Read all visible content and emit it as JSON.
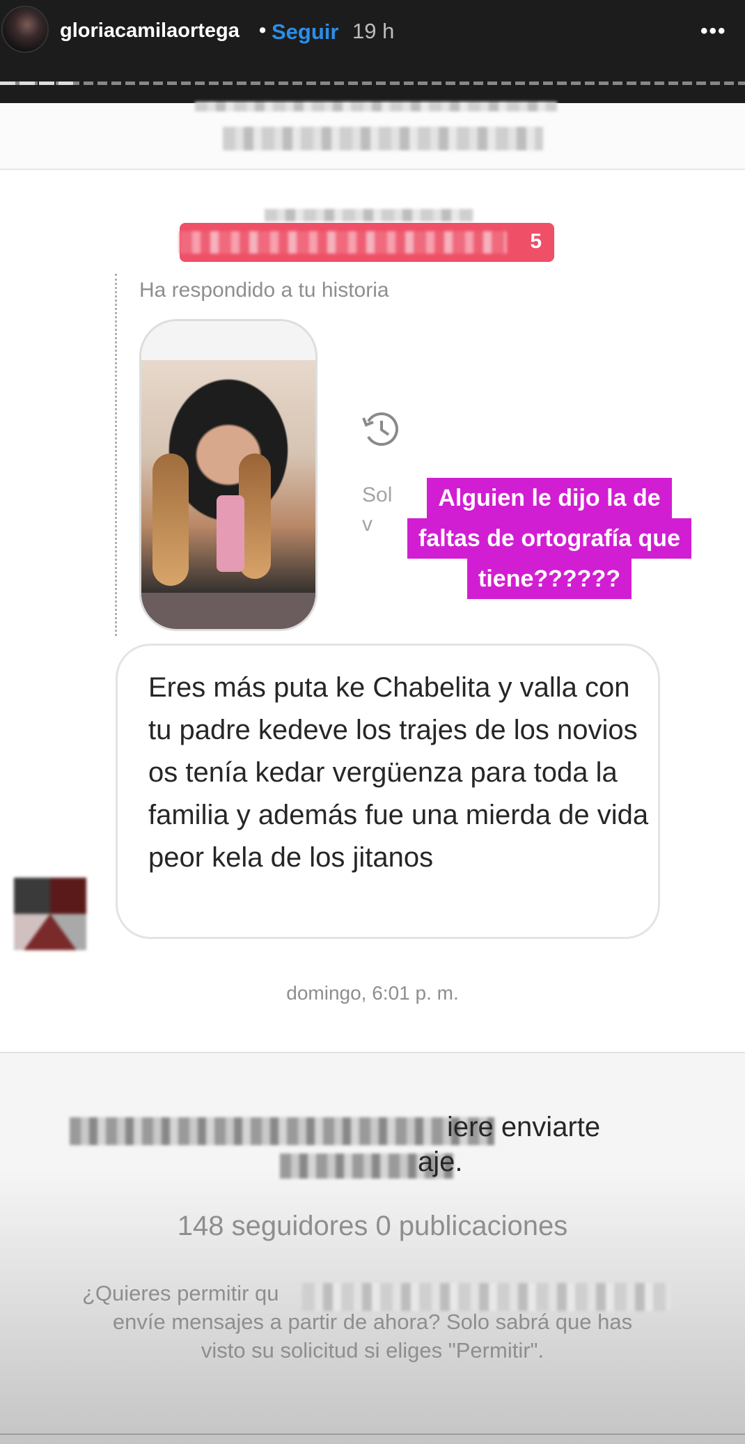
{
  "story": {
    "username": "gloriacamilaortega",
    "separator": "•",
    "follow_label": "Seguir",
    "time_ago": "19 h",
    "more_icon": "more-horizontal-icon",
    "more_label": "•••"
  },
  "chat": {
    "pill_number": "5",
    "reply_label": "Ha respondido a tu historia",
    "history_icon": "history-clock-icon",
    "partial_text_1": "Sol",
    "partial_text_2": "v",
    "caption_lines": [
      "Alguien le dijo la de",
      "faltas de ortografía que",
      "tiene??????"
    ],
    "message_text": "Eres más puta ke Chabelita y valla con tu padre kedeve los trajes de los novios os tenía kedar vergüenza para toda la familia y además fue una mierda de vida peor kela de los jitanos",
    "timestamp": "domingo, 6:01 p. m."
  },
  "request": {
    "line1_tail": "iere enviarte",
    "line2_tail": "aje.",
    "followers_text": "148 seguidores 0 publicaciones",
    "permit_line1": "¿Quieres permitir qu",
    "permit_line2": "envíe mensajes a partir de ahora? Solo sabrá que has",
    "permit_line3": "visto su solicitud si eliges \"Permitir\"."
  },
  "colors": {
    "follow": "#2a8fe8",
    "caption_bg": "#d21ed2",
    "pill_bg": "#ef4f67"
  }
}
